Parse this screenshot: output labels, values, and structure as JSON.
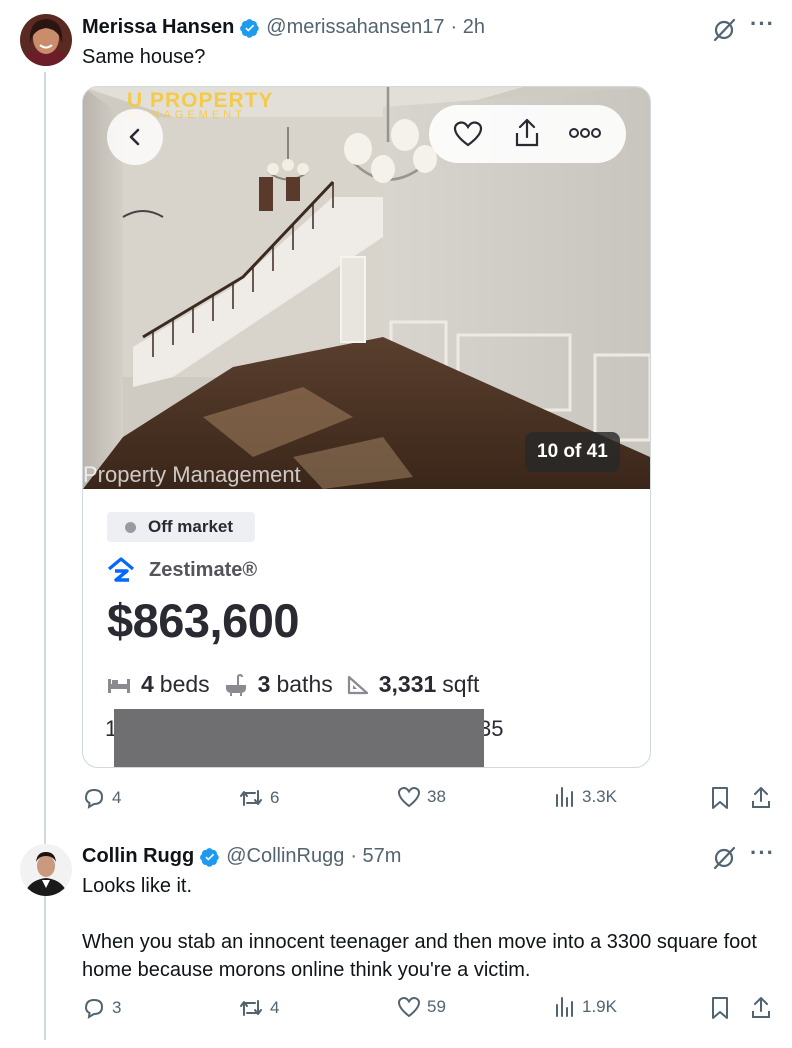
{
  "tweets": [
    {
      "name": "Merissa Hansen",
      "handle": "@merissahansen17",
      "time": "· 2h",
      "text": "Same house?",
      "stats": {
        "replies": "4",
        "reposts": "6",
        "likes": "38",
        "views": "3.3K"
      }
    },
    {
      "name": "Collin Rugg",
      "handle": "@CollinRugg",
      "time": "· 57m",
      "text": "Looks like it.\n\nWhen you stab an innocent teenager and then move into a 3300 square foot home because morons online think you're a victim.",
      "stats": {
        "replies": "3",
        "reposts": "4",
        "likes": "59",
        "views": "1.9K"
      }
    }
  ],
  "listing": {
    "photo_counter": "10 of 41",
    "logo_title": "U PROPERTY",
    "logo_subtitle": "MANAGEMENT",
    "watermark": "Property Management",
    "status": "Off market",
    "zestimate_label": "Zestimate®",
    "price": "$863,600",
    "beds_value": "4",
    "beds_label": "beds",
    "baths_value": "3",
    "baths_label": "baths",
    "sqft_value": "3,331",
    "sqft_label": "sqft",
    "address_start": "1",
    "address_end": "35"
  },
  "icons": [
    "reply-icon",
    "repost-icon",
    "like-icon",
    "views-icon",
    "bookmark-icon",
    "share-icon",
    "heart-icon",
    "upload-icon",
    "more-icon",
    "back-chevron-icon",
    "zillow-logo-icon",
    "bed-icon",
    "bath-icon",
    "sqft-icon",
    "verified-badge-icon",
    "grok-icon"
  ],
  "colors": {
    "verified": "#1d9bf0",
    "text": "#0f1419",
    "muted": "#536471",
    "zillow": "#006aff"
  }
}
